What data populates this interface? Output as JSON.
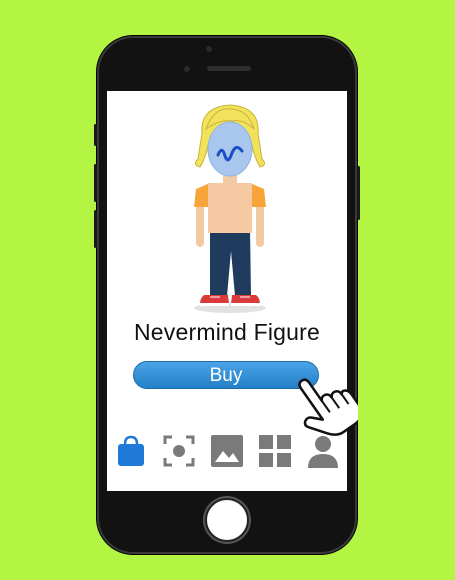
{
  "product": {
    "name": "Nevermind Figure",
    "buy_label": "Buy"
  },
  "colors": {
    "background": "#b3f542",
    "buy_button": "#2f8ed6",
    "active_icon": "#1e7ad6",
    "inactive_icon": "#7a7a7a"
  },
  "bottom_nav": [
    {
      "icon": "shopping-bag-icon",
      "active": true
    },
    {
      "icon": "scan-icon",
      "active": false
    },
    {
      "icon": "image-icon",
      "active": false
    },
    {
      "icon": "grid-icon",
      "active": false
    },
    {
      "icon": "profile-icon",
      "active": false
    }
  ]
}
